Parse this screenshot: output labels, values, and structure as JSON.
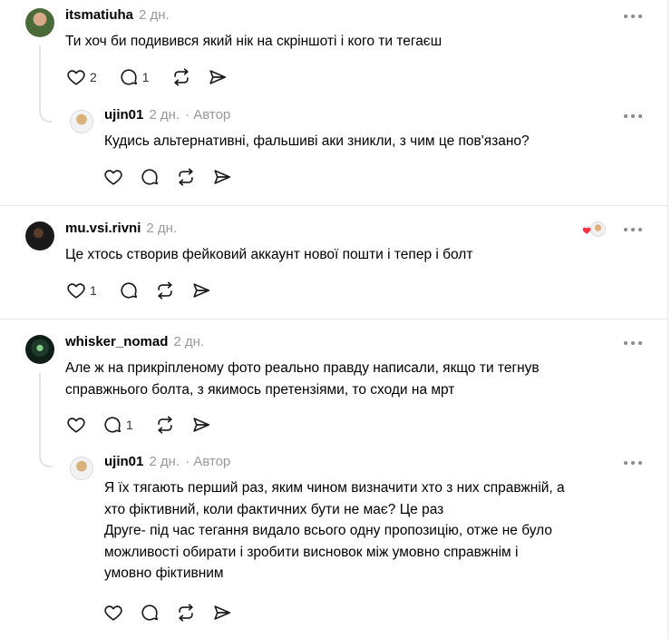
{
  "posts": [
    {
      "username": "itsmatiuha",
      "time": "2 дн.",
      "text": [
        "Ти хоч би подивився який нік на скріншоті і кого ти тегаєш"
      ],
      "likes": "2",
      "replies": "1",
      "avatar": "avatar-photo-man-green-shirt"
    },
    {
      "username": "ujin01",
      "time": "2 дн.",
      "author_tag": "· Автор",
      "text": [
        "Кудись альтернативні, фальшиві аки зникли, з чим це пов'язано?"
      ],
      "likes": "",
      "replies": "",
      "avatar": "avatar-photo-person-sunglasses"
    },
    {
      "username": "mu.vsi.rivni",
      "time": "2 дн.",
      "text": [
        "Це хтось створив фейковий аккаунт нової пошти і тепер і болт"
      ],
      "likes": "1",
      "replies": "",
      "avatar": "avatar-photo-dark",
      "liked_by_author": true
    },
    {
      "username": "whisker_nomad",
      "time": "2 дн.",
      "text": [
        "Але ж на прикріпленому фото реально правду написали, якщо ти тегнув",
        "справжнього болта, з якимось претензіями, то сходи на мрт"
      ],
      "likes": "",
      "replies": "1",
      "avatar": "avatar-photo-green-mask"
    },
    {
      "username": "ujin01",
      "time": "2 дн.",
      "author_tag": "· Автор",
      "text": [
        "Я їх тягають перший раз, яким чином визначити хто з них справжній, а",
        "хто фіктивний, коли фактичних бути не має? Це раз",
        "Друге- під час тегання видало всього одну пропозицію, отже не було",
        "можливості обирати і зробити висновок між умовно справжнім і",
        "умовно фіктивним"
      ],
      "likes": "",
      "replies": "",
      "avatar": "avatar-photo-person-sunglasses"
    }
  ],
  "icons": {
    "like": "heart-outline-icon",
    "reply": "speech-bubble-icon",
    "repost": "repost-arrows-icon",
    "share": "send-arrow-icon",
    "more": "more-dots-icon"
  },
  "colors": {
    "liked_badge": "#ff3040",
    "meta_gray": "#999999",
    "icon_stroke": "#1a1a1a"
  }
}
